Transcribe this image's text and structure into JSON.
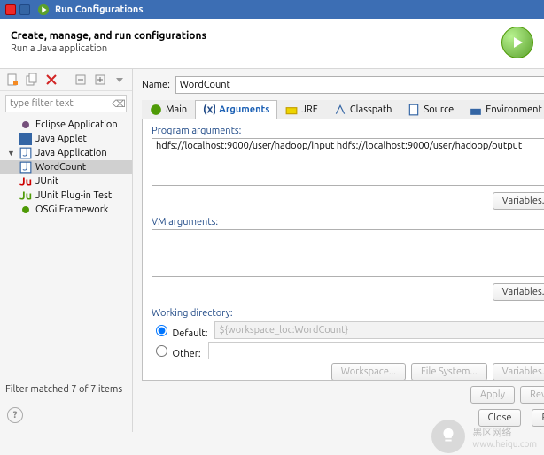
{
  "titlebar": {
    "title": "Run Configurations"
  },
  "header": {
    "title": "Create, manage, and run configurations",
    "subtitle": "Run a Java application"
  },
  "toolbar_icons": [
    "new-icon",
    "duplicate-icon",
    "delete-icon",
    "expand-icon",
    "collapse-icon"
  ],
  "filter": {
    "placeholder": "type filter text"
  },
  "tree": {
    "items": [
      {
        "label": "Eclipse Application",
        "icon": "purple"
      },
      {
        "label": "Java Applet",
        "icon": "applet"
      },
      {
        "label": "Java Application",
        "icon": "java",
        "expanded": true,
        "children": [
          {
            "label": "WordCount",
            "icon": "java",
            "selected": true
          }
        ]
      },
      {
        "label": "JUnit",
        "icon": "junit"
      },
      {
        "label": "JUnit Plug-in Test",
        "icon": "junit-plugin"
      },
      {
        "label": "OSGi Framework",
        "icon": "osgi"
      }
    ]
  },
  "filter_status": "Filter matched 7 of 7 items",
  "name": {
    "label": "Name:",
    "value": "WordCount"
  },
  "tabs": [
    {
      "label": "Main",
      "icon": "main"
    },
    {
      "label": "Arguments",
      "icon": "args",
      "active": true
    },
    {
      "label": "JRE",
      "icon": "jre"
    },
    {
      "label": "Classpath",
      "icon": "classpath"
    },
    {
      "label": "Source",
      "icon": "source"
    },
    {
      "label": "Environment",
      "icon": "env"
    }
  ],
  "args_panel": {
    "program_label": "Program arguments:",
    "program_value": "hdfs://localhost:9000/user/hadoop/input hdfs://localhost:9000/user/hadoop/output",
    "vm_label": "VM arguments:",
    "vm_value": "",
    "variables_btn": "Variables...",
    "wd_label": "Working directory:",
    "default_label": "Default:",
    "default_value": "${workspace_loc:WordCount}",
    "other_label": "Other:",
    "workspace_btn": "Workspace...",
    "filesystem_btn": "File System...",
    "variables2_btn": "Variables..."
  },
  "footer": {
    "apply": "Apply",
    "revert": "Revert",
    "close": "Close",
    "run": "Run"
  },
  "watermark": {
    "text": "黑区网络",
    "url": "www.heiqu.com"
  }
}
